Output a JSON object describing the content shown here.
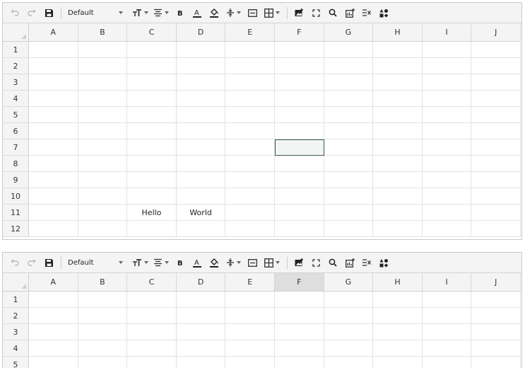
{
  "toolbar": {
    "undo_icon": "undo-icon",
    "redo_icon": "redo-icon",
    "save_icon": "save-icon",
    "font_name": "Default",
    "items": [
      "text-size-icon",
      "align-icon",
      "bold-icon",
      "text-color-icon",
      "fill-color-icon",
      "valign-icon",
      "wrap-icon",
      "borders-icon",
      "insert-image-icon",
      "fullscreen-icon",
      "search-icon",
      "insert-chart-icon",
      "clear-format-icon",
      "shapes-icon"
    ]
  },
  "columns": [
    "A",
    "B",
    "C",
    "D",
    "E",
    "F",
    "G",
    "H",
    "I",
    "J"
  ],
  "rows": [
    "1",
    "2",
    "3",
    "4",
    "5",
    "6",
    "7",
    "8",
    "9",
    "10",
    "11",
    "12"
  ],
  "sheet1": {
    "cells": {
      "C11": "Hello",
      "D11": "World"
    },
    "active_cell": "F7"
  },
  "sheet2": {
    "rows": [
      "1",
      "2",
      "3",
      "4",
      "5"
    ],
    "selected_column": "F"
  },
  "colors": {
    "active_cell_border": "#3d5a4d",
    "header_bg": "#f4f4f4",
    "selected_header_bg": "#dedede"
  }
}
